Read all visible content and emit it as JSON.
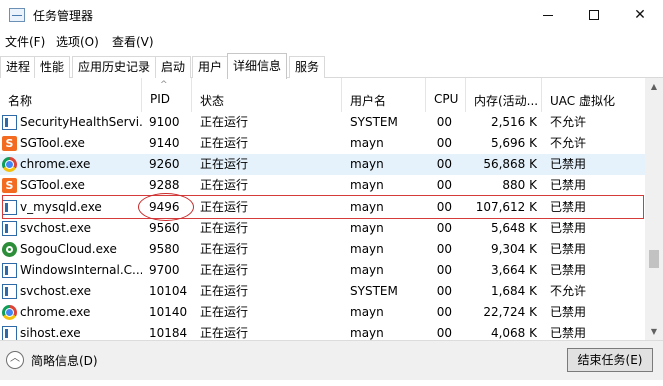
{
  "window": {
    "title": "任务管理器",
    "icon": "task-manager-icon"
  },
  "menu": {
    "file": "文件(F)",
    "options": "选项(O)",
    "view": "查看(V)"
  },
  "tabs": [
    {
      "label": "进程",
      "active": false
    },
    {
      "label": "性能",
      "active": false
    },
    {
      "label": "应用历史记录",
      "active": false
    },
    {
      "label": "启动",
      "active": false
    },
    {
      "label": "用户",
      "active": false
    },
    {
      "label": "详细信息",
      "active": true
    },
    {
      "label": "服务",
      "active": false
    }
  ],
  "columns": {
    "name": "名称",
    "pid": "PID",
    "status": "状态",
    "user": "用户名",
    "cpu": "CPU",
    "memory": "内存(活动...",
    "uac": "UAC 虚拟化"
  },
  "rows": [
    {
      "icon": "windows-app-icon",
      "name": "SecurityHealthServi...",
      "pid": "9100",
      "status": "正在运行",
      "user": "SYSTEM",
      "cpu": "00",
      "memory": "2,516 K",
      "uac": "不允许"
    },
    {
      "icon": "sgtool-icon",
      "name": "SGTool.exe",
      "pid": "9140",
      "status": "正在运行",
      "user": "mayn",
      "cpu": "00",
      "memory": "5,696 K",
      "uac": "不允许"
    },
    {
      "icon": "chrome-icon",
      "name": "chrome.exe",
      "pid": "9260",
      "status": "正在运行",
      "user": "mayn",
      "cpu": "00",
      "memory": "56,868 K",
      "uac": "已禁用"
    },
    {
      "icon": "sgtool-icon",
      "name": "SGTool.exe",
      "pid": "9288",
      "status": "正在运行",
      "user": "mayn",
      "cpu": "00",
      "memory": "880 K",
      "uac": "已禁用"
    },
    {
      "icon": "windows-app-icon",
      "name": "v_mysqld.exe",
      "pid": "9496",
      "status": "正在运行",
      "user": "mayn",
      "cpu": "00",
      "memory": "107,612 K",
      "uac": "已禁用"
    },
    {
      "icon": "windows-app-icon",
      "name": "svchost.exe",
      "pid": "9560",
      "status": "正在运行",
      "user": "mayn",
      "cpu": "00",
      "memory": "5,648 K",
      "uac": "已禁用"
    },
    {
      "icon": "sogou-icon",
      "name": "SogouCloud.exe",
      "pid": "9580",
      "status": "正在运行",
      "user": "mayn",
      "cpu": "00",
      "memory": "9,304 K",
      "uac": "已禁用"
    },
    {
      "icon": "windows-app-icon",
      "name": "WindowsInternal.C...",
      "pid": "9700",
      "status": "正在运行",
      "user": "mayn",
      "cpu": "00",
      "memory": "3,664 K",
      "uac": "已禁用"
    },
    {
      "icon": "windows-app-icon",
      "name": "svchost.exe",
      "pid": "10104",
      "status": "正在运行",
      "user": "SYSTEM",
      "cpu": "00",
      "memory": "1,684 K",
      "uac": "不允许"
    },
    {
      "icon": "chrome-icon",
      "name": "chrome.exe",
      "pid": "10140",
      "status": "正在运行",
      "user": "mayn",
      "cpu": "00",
      "memory": "22,724 K",
      "uac": "已禁用"
    },
    {
      "icon": "windows-app-icon",
      "name": "sihost.exe",
      "pid": "10184",
      "status": "正在运行",
      "user": "mayn",
      "cpu": "00",
      "memory": "4,068 K",
      "uac": "已禁用"
    }
  ],
  "footer": {
    "fewer_details": "简略信息(D)",
    "end_task": "结束任务(E)"
  },
  "colors": {
    "highlight": "#d63b3b",
    "selected_row": "#e5f1fb",
    "sgtool": "#f36b21"
  }
}
